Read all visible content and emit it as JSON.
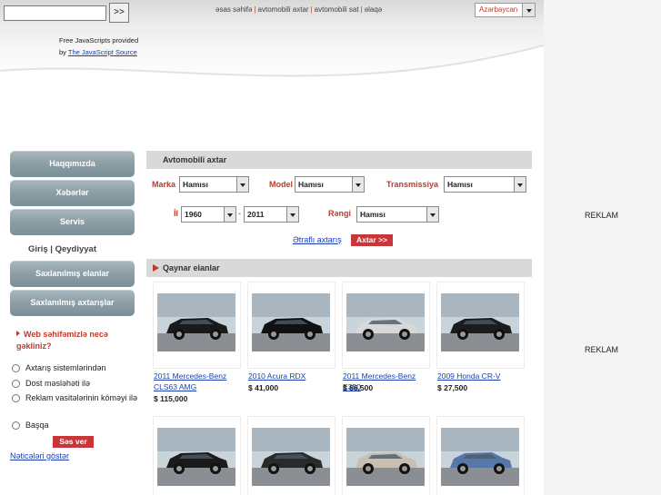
{
  "search": {
    "value": "",
    "go_label": ">>"
  },
  "top_nav": {
    "items": [
      "əsas səhifə",
      "avtomobili axtar",
      "avtomobili sat",
      "əlaqə"
    ]
  },
  "language": {
    "selected": "Azərbaycan"
  },
  "credit": {
    "line1": "Free JavaScripts provided",
    "by": "by",
    "link": "The JavaScript Source"
  },
  "sidebar": {
    "buttons": [
      "Haqqımızda",
      "Xəbərlər",
      "Servis"
    ],
    "login": "Giriş | Qeydiyyat",
    "buttons2": [
      "Saxlanılmış elanlar",
      "Saxlanılmış axtarışlar"
    ]
  },
  "poll": {
    "question": "Web səhifəmizlə necə gəkliniz?",
    "options": [
      "Axtarış sistemlərindən",
      "Dost məsləhəti ilə",
      "Reklam vasitələrinin köməyi ilə",
      "Başqa"
    ],
    "vote_label": "Səs ver",
    "results_link": "Nəticələri göstər"
  },
  "search_form": {
    "title": "Avtomobili axtar",
    "marka_label": "Marka",
    "marka_value": "Hamısı",
    "model_label": "Model",
    "model_value": "Hamısı",
    "transmission_label": "Transmissiya",
    "transmission_value": "Hamısı",
    "year_label": "İl",
    "year_from": "1960",
    "year_to": "2011",
    "year_sep": "-",
    "color_label": "Rəngi",
    "color_value": "Hamısı",
    "advanced_link": "Ətraflı axtarış",
    "submit_label": "Axtar >>"
  },
  "listings": {
    "title": "Qaynar elanlar",
    "row1": [
      {
        "title": "2011 Mercedes-Benz CLS63 AMG",
        "price": "$ 115,000",
        "color": "#1a1a1a"
      },
      {
        "title": "2010 Acura RDX",
        "price": "$ 41,000",
        "color": "#111111"
      },
      {
        "title": "2011 Mercedes-Benz E350",
        "price": "$ 66,500",
        "color": "#d8d8d8"
      },
      {
        "title": "2009 Honda CR-V",
        "price": "$ 27,500",
        "color": "#1c1c1c"
      }
    ],
    "row2": [
      {
        "color": "#1a1a1a"
      },
      {
        "color": "#2a2a2a"
      },
      {
        "color": "#c9bfb0"
      },
      {
        "color": "#5577aa"
      }
    ]
  },
  "ads": {
    "label1": "REKLAM",
    "label2": "REKLAM"
  },
  "colors": {
    "accent": "#c0392b",
    "link": "#1a3fb0",
    "sidebar_button": "#8c9ea5",
    "section_header": "#d9d9d9"
  }
}
